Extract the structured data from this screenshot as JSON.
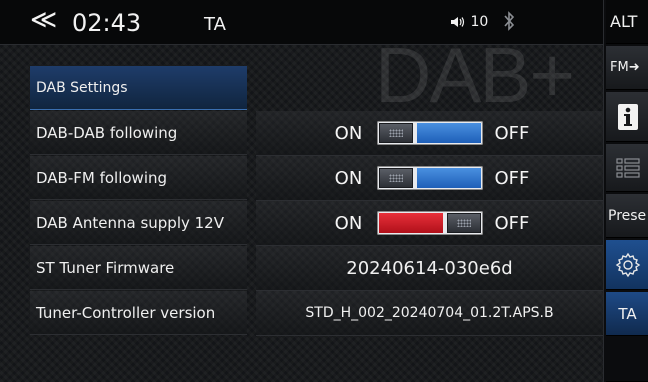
{
  "status_bar": {
    "back_icon": "double-chevron-left-icon",
    "time": "02:43",
    "ta": "TA",
    "volume_icon": "speaker-icon",
    "volume": "10",
    "bluetooth_icon": "bluetooth-icon"
  },
  "watermark": "DAB+",
  "settings": {
    "header": "DAB Settings",
    "rows": [
      {
        "label": "DAB-DAB following",
        "on": "ON",
        "off": "OFF",
        "state": "off"
      },
      {
        "label": "DAB-FM following",
        "on": "ON",
        "off": "OFF",
        "state": "off"
      },
      {
        "label": "DAB Antenna supply 12V",
        "on": "ON",
        "off": "OFF",
        "state": "on"
      },
      {
        "label": "ST Tuner Firmware",
        "value": "20240614-030e6d"
      },
      {
        "label": "Tuner-Controller version",
        "value": "STD_H_002_20240704_01.2T.APS.B"
      }
    ]
  },
  "right_panel": {
    "alt": "ALT",
    "fm": "FM➜",
    "info_icon": "info-icon",
    "list_icon": "list-icon",
    "presets": "Prese",
    "gear_icon": "gear-icon",
    "ta": "TA"
  },
  "colors": {
    "accent_blue": "#1e5fb8",
    "toggle_on_red": "#d0202a",
    "header_blue": "#1e3c6a"
  }
}
